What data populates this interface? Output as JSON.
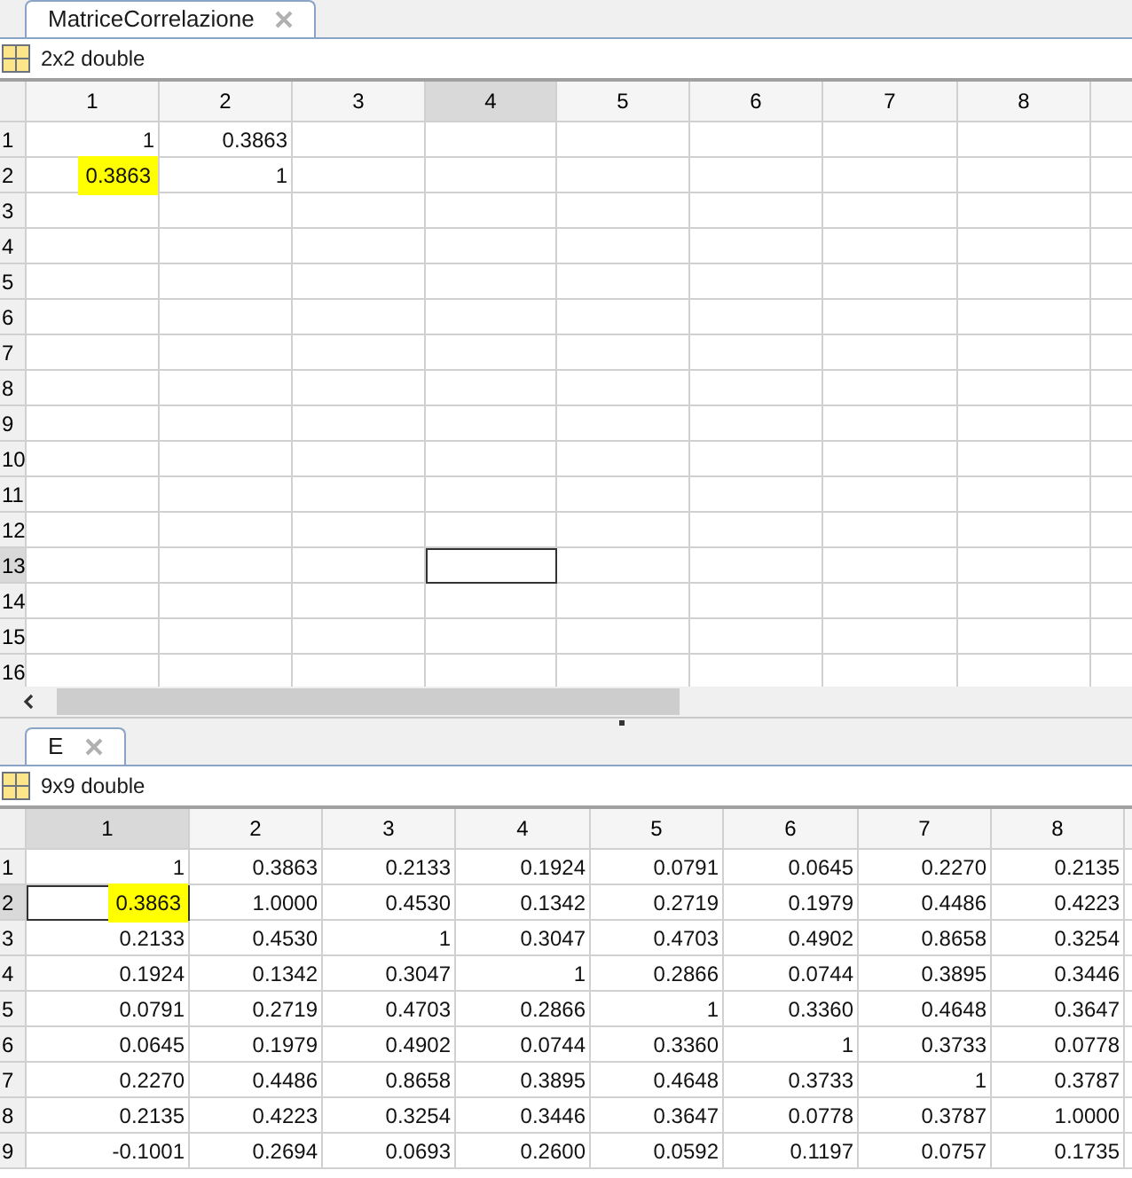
{
  "panels": [
    {
      "tab": {
        "label": "MatriceCorrelazione",
        "selected": true
      },
      "size_label": "2x2 double",
      "columns": [
        {
          "label": "1",
          "selected": false
        },
        {
          "label": "2",
          "selected": false
        },
        {
          "label": "3",
          "selected": false
        },
        {
          "label": "4",
          "selected": true
        },
        {
          "label": "5",
          "selected": false
        },
        {
          "label": "6",
          "selected": false
        },
        {
          "label": "7",
          "selected": false
        },
        {
          "label": "8",
          "selected": false
        }
      ],
      "rows": [
        {
          "label": "1",
          "selected": false,
          "cells": [
            {
              "text": "1",
              "highlighted": false
            },
            {
              "text": "0.3863",
              "highlighted": false
            }
          ]
        },
        {
          "label": "2",
          "selected": false,
          "cells": [
            {
              "text": "0.3863",
              "highlighted": true
            },
            {
              "text": "1",
              "highlighted": false
            }
          ]
        },
        {
          "label": "3",
          "selected": false
        },
        {
          "label": "4",
          "selected": false
        },
        {
          "label": "5",
          "selected": false
        },
        {
          "label": "6",
          "selected": false
        },
        {
          "label": "7",
          "selected": false
        },
        {
          "label": "8",
          "selected": false
        },
        {
          "label": "9",
          "selected": false
        },
        {
          "label": "10",
          "selected": false
        },
        {
          "label": "11",
          "selected": false
        },
        {
          "label": "12",
          "selected": false
        },
        {
          "label": "13",
          "selected": true
        },
        {
          "label": "14",
          "selected": false
        },
        {
          "label": "15",
          "selected": false
        },
        {
          "label": "16",
          "selected": false
        }
      ],
      "scrollbar": true
    },
    {
      "tab": {
        "label": "E",
        "selected": true
      },
      "size_label": "9x9 double",
      "columns": [
        {
          "label": "1",
          "selected": true
        },
        {
          "label": "2",
          "selected": false
        },
        {
          "label": "3",
          "selected": false
        },
        {
          "label": "4",
          "selected": false
        },
        {
          "label": "5",
          "selected": false
        },
        {
          "label": "6",
          "selected": false
        },
        {
          "label": "7",
          "selected": false
        },
        {
          "label": "8",
          "selected": false
        }
      ],
      "rows": [
        {
          "label": "1",
          "selected": false,
          "cells": [
            {
              "text": "1",
              "highlighted": false
            },
            {
              "text": "0.3863",
              "highlighted": false
            },
            {
              "text": "0.2133",
              "highlighted": false
            },
            {
              "text": "0.1924",
              "highlighted": false
            },
            {
              "text": "0.0791",
              "highlighted": false
            },
            {
              "text": "0.0645",
              "highlighted": false
            },
            {
              "text": "0.2270",
              "highlighted": false
            },
            {
              "text": "0.2135",
              "highlighted": false
            }
          ]
        },
        {
          "label": "2",
          "selected": true,
          "cells": [
            {
              "text": "0.3863",
              "highlighted": true
            },
            {
              "text": "1.0000",
              "highlighted": false
            },
            {
              "text": "0.4530",
              "highlighted": false
            },
            {
              "text": "0.1342",
              "highlighted": false
            },
            {
              "text": "0.2719",
              "highlighted": false
            },
            {
              "text": "0.1979",
              "highlighted": false
            },
            {
              "text": "0.4486",
              "highlighted": false
            },
            {
              "text": "0.4223",
              "highlighted": false
            }
          ]
        },
        {
          "label": "3",
          "selected": false,
          "cells": [
            {
              "text": "0.2133",
              "highlighted": false
            },
            {
              "text": "0.4530",
              "highlighted": false
            },
            {
              "text": "1",
              "highlighted": false
            },
            {
              "text": "0.3047",
              "highlighted": false
            },
            {
              "text": "0.4703",
              "highlighted": false
            },
            {
              "text": "0.4902",
              "highlighted": false
            },
            {
              "text": "0.8658",
              "highlighted": false
            },
            {
              "text": "0.3254",
              "highlighted": false
            }
          ]
        },
        {
          "label": "4",
          "selected": false,
          "cells": [
            {
              "text": "0.1924",
              "highlighted": false
            },
            {
              "text": "0.1342",
              "highlighted": false
            },
            {
              "text": "0.3047",
              "highlighted": false
            },
            {
              "text": "1",
              "highlighted": false
            },
            {
              "text": "0.2866",
              "highlighted": false
            },
            {
              "text": "0.0744",
              "highlighted": false
            },
            {
              "text": "0.3895",
              "highlighted": false
            },
            {
              "text": "0.3446",
              "highlighted": false
            }
          ]
        },
        {
          "label": "5",
          "selected": false,
          "cells": [
            {
              "text": "0.0791",
              "highlighted": false
            },
            {
              "text": "0.2719",
              "highlighted": false
            },
            {
              "text": "0.4703",
              "highlighted": false
            },
            {
              "text": "0.2866",
              "highlighted": false
            },
            {
              "text": "1",
              "highlighted": false
            },
            {
              "text": "0.3360",
              "highlighted": false
            },
            {
              "text": "0.4648",
              "highlighted": false
            },
            {
              "text": "0.3647",
              "highlighted": false
            }
          ]
        },
        {
          "label": "6",
          "selected": false,
          "cells": [
            {
              "text": "0.0645",
              "highlighted": false
            },
            {
              "text": "0.1979",
              "highlighted": false
            },
            {
              "text": "0.4902",
              "highlighted": false
            },
            {
              "text": "0.0744",
              "highlighted": false
            },
            {
              "text": "0.3360",
              "highlighted": false
            },
            {
              "text": "1",
              "highlighted": false
            },
            {
              "text": "0.3733",
              "highlighted": false
            },
            {
              "text": "0.0778",
              "highlighted": false
            }
          ]
        },
        {
          "label": "7",
          "selected": false,
          "cells": [
            {
              "text": "0.2270",
              "highlighted": false
            },
            {
              "text": "0.4486",
              "highlighted": false
            },
            {
              "text": "0.8658",
              "highlighted": false
            },
            {
              "text": "0.3895",
              "highlighted": false
            },
            {
              "text": "0.4648",
              "highlighted": false
            },
            {
              "text": "0.3733",
              "highlighted": false
            },
            {
              "text": "1",
              "highlighted": false
            },
            {
              "text": "0.3787",
              "highlighted": false
            }
          ]
        },
        {
          "label": "8",
          "selected": false,
          "cells": [
            {
              "text": "0.2135",
              "highlighted": false
            },
            {
              "text": "0.4223",
              "highlighted": false
            },
            {
              "text": "0.3254",
              "highlighted": false
            },
            {
              "text": "0.3446",
              "highlighted": false
            },
            {
              "text": "0.3647",
              "highlighted": false
            },
            {
              "text": "0.0778",
              "highlighted": false
            },
            {
              "text": "0.3787",
              "highlighted": false
            },
            {
              "text": "1.0000",
              "highlighted": false
            }
          ]
        },
        {
          "label": "9",
          "selected": false,
          "cells": [
            {
              "text": "-0.1001",
              "highlighted": false
            },
            {
              "text": "0.2694",
              "highlighted": false
            },
            {
              "text": "0.0693",
              "highlighted": false
            },
            {
              "text": "0.2600",
              "highlighted": false
            },
            {
              "text": "0.0592",
              "highlighted": false
            },
            {
              "text": "0.1197",
              "highlighted": false
            },
            {
              "text": "0.0757",
              "highlighted": false
            },
            {
              "text": "0.1735",
              "highlighted": false
            }
          ]
        }
      ],
      "scrollbar": false
    }
  ]
}
